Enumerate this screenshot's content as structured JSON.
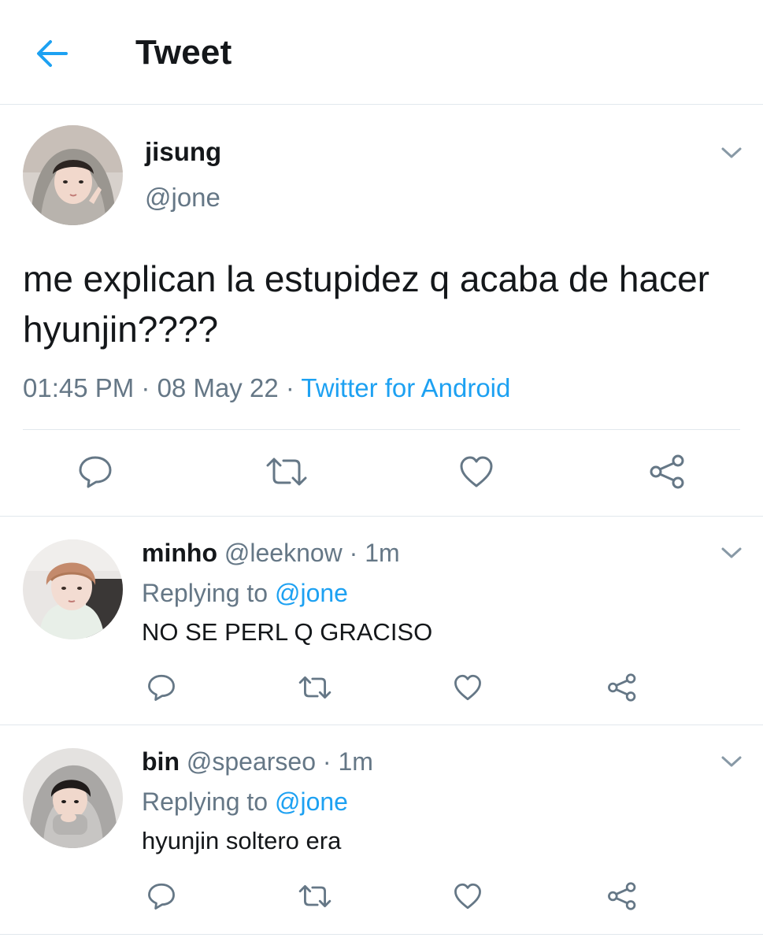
{
  "header": {
    "title": "Tweet"
  },
  "tweet": {
    "name": "jisung",
    "handle": "@jone",
    "text": "me explican la estupidez q acaba de hacer hyunjin????",
    "time": "01:45 PM",
    "sep1": " · ",
    "date": "08 May 22",
    "sep2": " · ",
    "source": "Twitter for Android"
  },
  "replies": [
    {
      "name": "minho",
      "handle": "@leeknow",
      "dot": " · ",
      "age": "1m",
      "replying_prefix": "Replying to ",
      "replying_to": "@jone",
      "text": "NO SE PERL Q GRACISO"
    },
    {
      "name": "bin",
      "handle": "@spearseo",
      "dot": " · ",
      "age": "1m",
      "replying_prefix": "Replying to ",
      "replying_to": "@jone",
      "text": "hyunjin soltero era"
    }
  ],
  "colors": {
    "accent": "#1da1f2",
    "text": "#14171a",
    "secondary": "#657786",
    "divider": "#e1e8ed"
  },
  "icons": {
    "back": "arrow-left-icon",
    "reply": "speech-bubble-icon",
    "retweet": "retweet-arrows-icon",
    "like": "heart-icon",
    "share": "share-nodes-icon",
    "more": "chevron-down-icon"
  }
}
